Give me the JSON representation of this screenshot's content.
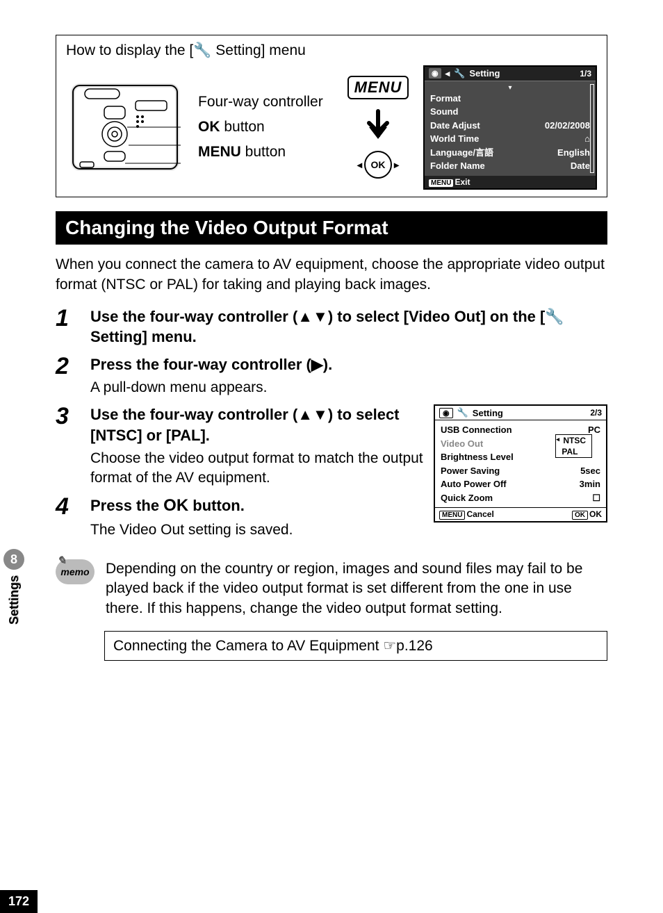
{
  "sideTab": {
    "number": "8",
    "label": "Settings"
  },
  "pageNumber": "172",
  "box1": {
    "title_pre": "How to display the [",
    "title_icon": "🔧",
    "title_post": " Setting] menu",
    "label_fourway": "Four-way controller",
    "label_ok_pre": "OK",
    "label_ok_post": "  button",
    "label_menu_pre": "MENU",
    "label_menu_post": " button",
    "menu_word": "MENU",
    "ok_word": "OK"
  },
  "screen1": {
    "title": "Setting",
    "page": "1/3",
    "rows": [
      {
        "l": "Format",
        "r": ""
      },
      {
        "l": "Sound",
        "r": ""
      },
      {
        "l": "Date Adjust",
        "r": "02/02/2008"
      },
      {
        "l": "World Time",
        "r": "⌂"
      },
      {
        "l": "Language/言語",
        "r": "English"
      },
      {
        "l": "Folder Name",
        "r": "Date"
      }
    ],
    "exit_btn": "MENU",
    "exit_label": "Exit"
  },
  "sectionHeader": "Changing the Video Output Format",
  "intro": "When you connect the camera to AV equipment, choose the appropriate video output format (NTSC or PAL) for taking and playing back images.",
  "steps": {
    "s1": {
      "num": "1",
      "title_a": "Use the four-way controller (▲▼) to select [Video Out] on the [",
      "title_icon": "🔧",
      "title_b": " Setting] menu."
    },
    "s2": {
      "num": "2",
      "title": "Press the four-way controller (▶).",
      "desc": "A pull-down menu appears."
    },
    "s3": {
      "num": "3",
      "title": "Use the four-way controller (▲▼) to select [NTSC] or [PAL].",
      "desc": "Choose the video output format to match the output format of the AV equipment."
    },
    "s4": {
      "num": "4",
      "title_a": "Press the ",
      "title_b": "OK",
      "title_c": "  button.",
      "desc": "The Video Out setting is saved."
    }
  },
  "screen2": {
    "title": "Setting",
    "page": "2/3",
    "rows": [
      {
        "l": "USB Connection",
        "r": "PC"
      },
      {
        "l": "Video Out",
        "r": "NTSC"
      },
      {
        "l": "Brightness Level",
        "r": ""
      },
      {
        "l": "Power Saving",
        "r": "5sec"
      },
      {
        "l": "Auto Power Off",
        "r": "3min"
      },
      {
        "l": "Quick Zoom",
        "r": "☐"
      }
    ],
    "dropdown": [
      "NTSC",
      "PAL"
    ],
    "cancel_btn": "MENU",
    "cancel_label": "Cancel",
    "ok_btn": "OK",
    "ok_label": "OK"
  },
  "memo": {
    "label": "memo",
    "text": "Depending on the country or region, images and sound files may fail to be played back if the video output format is set different from the one in use there. If this happens, change the video output format setting."
  },
  "xref": "Connecting the Camera to AV Equipment ☞p.126"
}
